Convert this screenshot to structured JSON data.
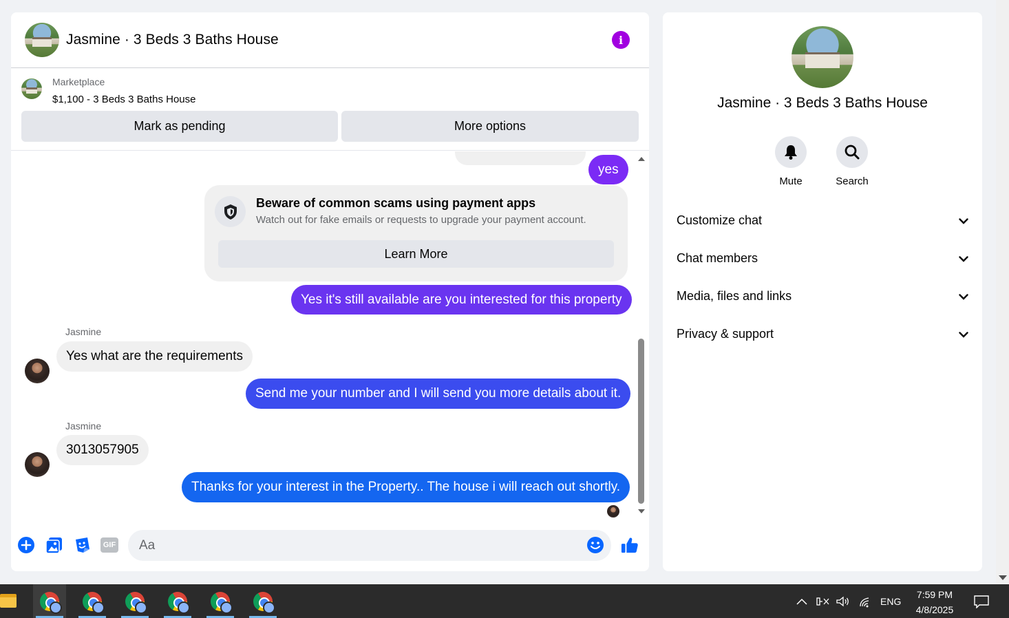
{
  "chat": {
    "title": "Jasmine · 3 Beds 3 Baths House",
    "marketplace": {
      "label": "Marketplace",
      "listing": "$1,100 - 3 Beds 3 Baths House",
      "pending_button": "Mark as pending",
      "more_button": "More options"
    },
    "messages": [
      {
        "type": "outgoing",
        "text": "yes",
        "color": "#7b2bf5"
      },
      {
        "type": "outgoing",
        "text": "Yes it's still available are you interested for this property",
        "color": "#6a34f0"
      },
      {
        "type": "incoming",
        "sender": "Jasmine",
        "text": "Yes what are the requirements"
      },
      {
        "type": "outgoing",
        "text": "Send me your number and I will send you more details about it.",
        "color": "#3b4cef"
      },
      {
        "type": "incoming",
        "sender": "Jasmine",
        "text": "3013057905"
      },
      {
        "type": "outgoing",
        "text": "Thanks for your interest in the Property.. The house i will reach  out shortly.",
        "color": "#1466f0"
      }
    ],
    "scam_notice": {
      "title": "Beware of common scams using payment apps",
      "subtitle": "Watch out for fake emails or requests to upgrade your payment account.",
      "button": "Learn More"
    },
    "composer": {
      "placeholder": "Aa",
      "gif_label": "GIF"
    }
  },
  "info_panel": {
    "title": "Jasmine · 3 Beds 3 Baths House",
    "actions": [
      {
        "label": "Mute",
        "icon": "bell-icon"
      },
      {
        "label": "Search",
        "icon": "search-icon"
      }
    ],
    "sections": [
      "Customize chat",
      "Chat members",
      "Media, files and links",
      "Privacy & support"
    ]
  },
  "taskbar": {
    "language": "ENG",
    "time": "7:59 PM",
    "date": "4/8/2025"
  },
  "colors": {
    "accent_purple": "#a100e0",
    "messenger_blue": "#0084ff",
    "taskbar": "#2b2b2b"
  }
}
